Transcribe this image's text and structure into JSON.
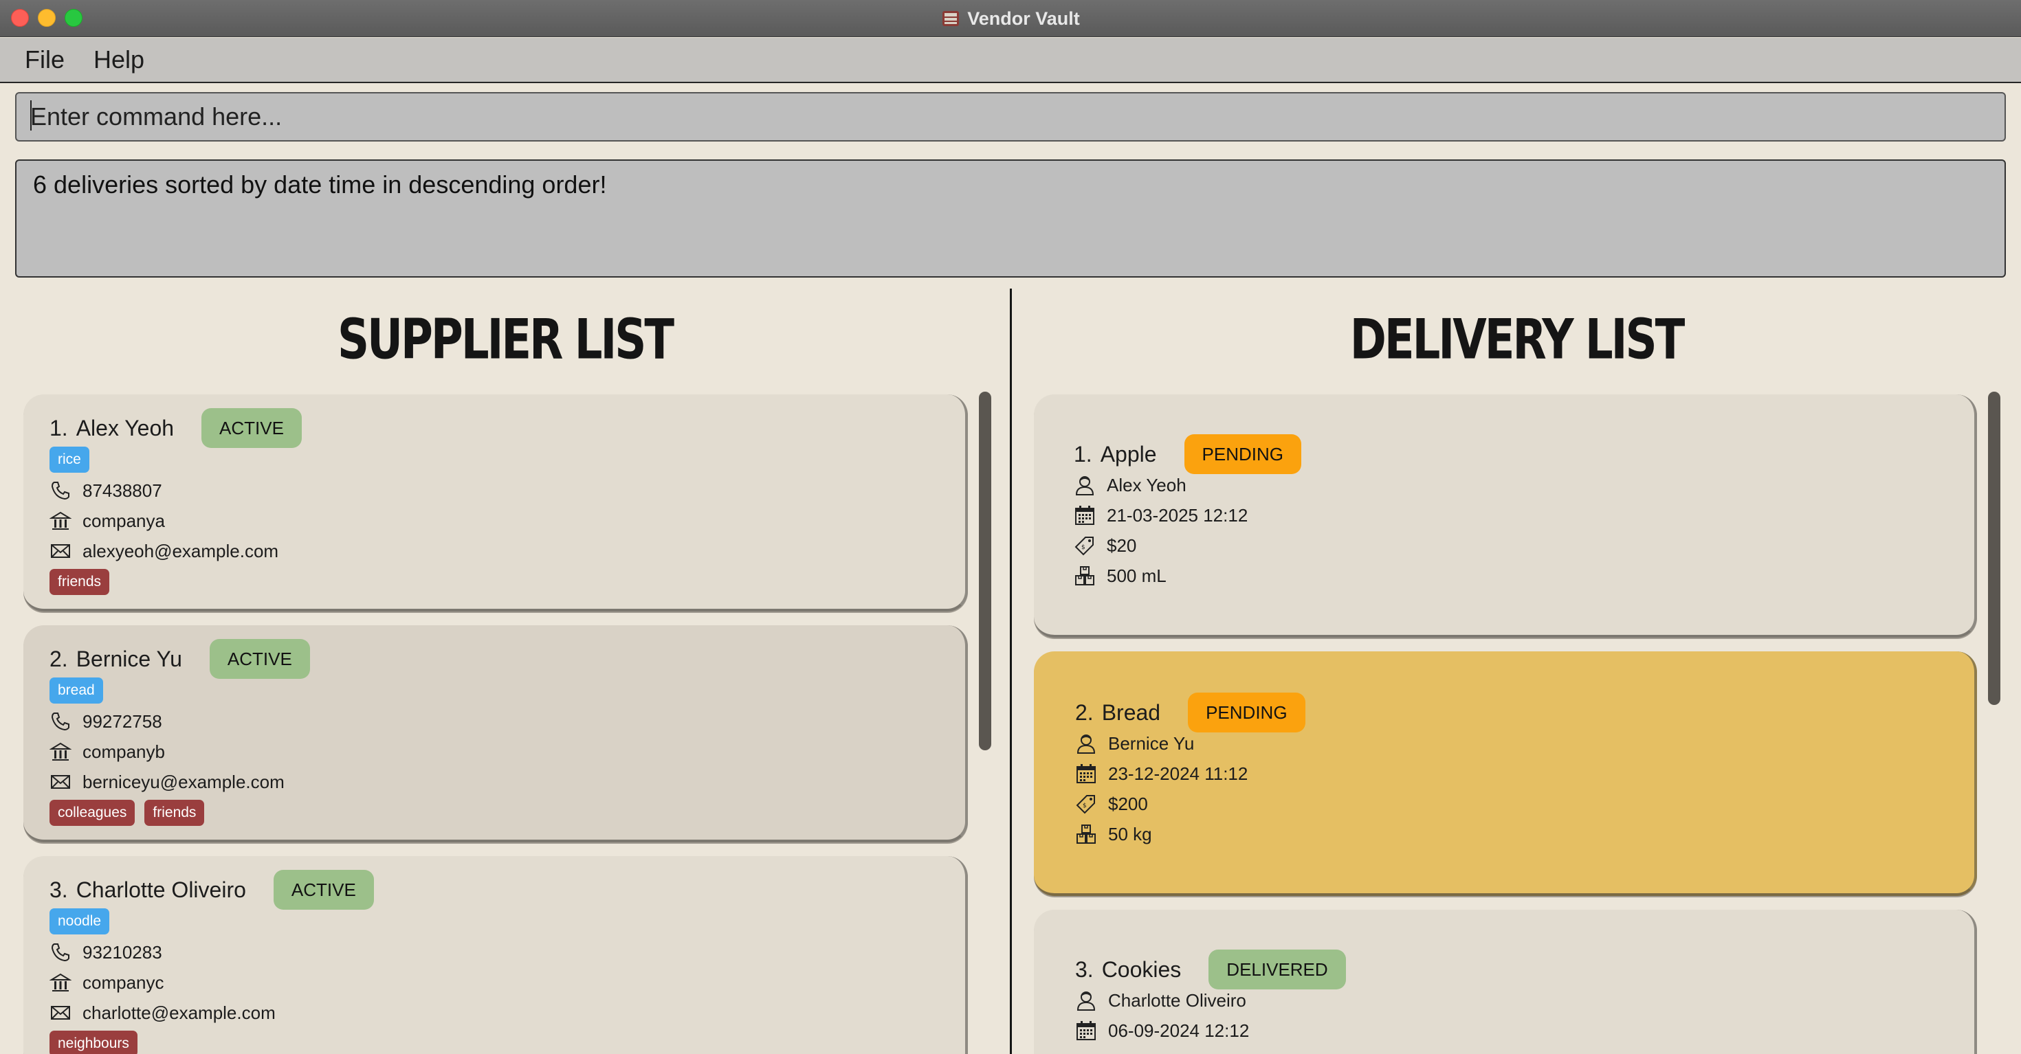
{
  "window": {
    "title": "Vendor Vault"
  },
  "menu": {
    "file": "File",
    "help": "Help"
  },
  "command": {
    "placeholder": "Enter command here..."
  },
  "result": {
    "message": "6 deliveries sorted by date time in descending order!"
  },
  "suppliers": {
    "header": "SUPPLIER LIST",
    "items": [
      {
        "index": "1.",
        "name": "Alex Yeoh",
        "status": "ACTIVE",
        "product": "rice",
        "phone": "87438807",
        "company": "companya",
        "email": "alexyeoh@example.com",
        "tags": [
          "friends"
        ]
      },
      {
        "index": "2.",
        "name": "Bernice Yu",
        "status": "ACTIVE",
        "product": "bread",
        "phone": "99272758",
        "company": "companyb",
        "email": "berniceyu@example.com",
        "tags": [
          "colleagues",
          "friends"
        ]
      },
      {
        "index": "3.",
        "name": "Charlotte Oliveiro",
        "status": "ACTIVE",
        "product": "noodle",
        "phone": "93210283",
        "company": "companyc",
        "email": "charlotte@example.com",
        "tags": [
          "neighbours"
        ]
      }
    ]
  },
  "deliveries": {
    "header": "DELIVERY LIST",
    "items": [
      {
        "index": "1.",
        "product": "Apple",
        "status": "PENDING",
        "supplier": "Alex Yeoh",
        "datetime": "21-03-2025 12:12",
        "cost": "$20",
        "quantity": "500 mL"
      },
      {
        "index": "2.",
        "product": "Bread",
        "status": "PENDING",
        "supplier": "Bernice Yu",
        "datetime": "23-12-2024 11:12",
        "cost": "$200",
        "quantity": "50 kg"
      },
      {
        "index": "3.",
        "product": "Cookies",
        "status": "DELIVERED",
        "supplier": "Charlotte Oliveiro",
        "datetime": "06-09-2024 12:12"
      }
    ]
  },
  "colors": {
    "background": "#ece6da",
    "card": "#e2dcd0",
    "selected_card": "#e5bf63",
    "status_active": "#9cc08a",
    "status_pending": "#fba20e",
    "product_tag": "#46a7ec",
    "label_tag": "#9a3e3e"
  }
}
